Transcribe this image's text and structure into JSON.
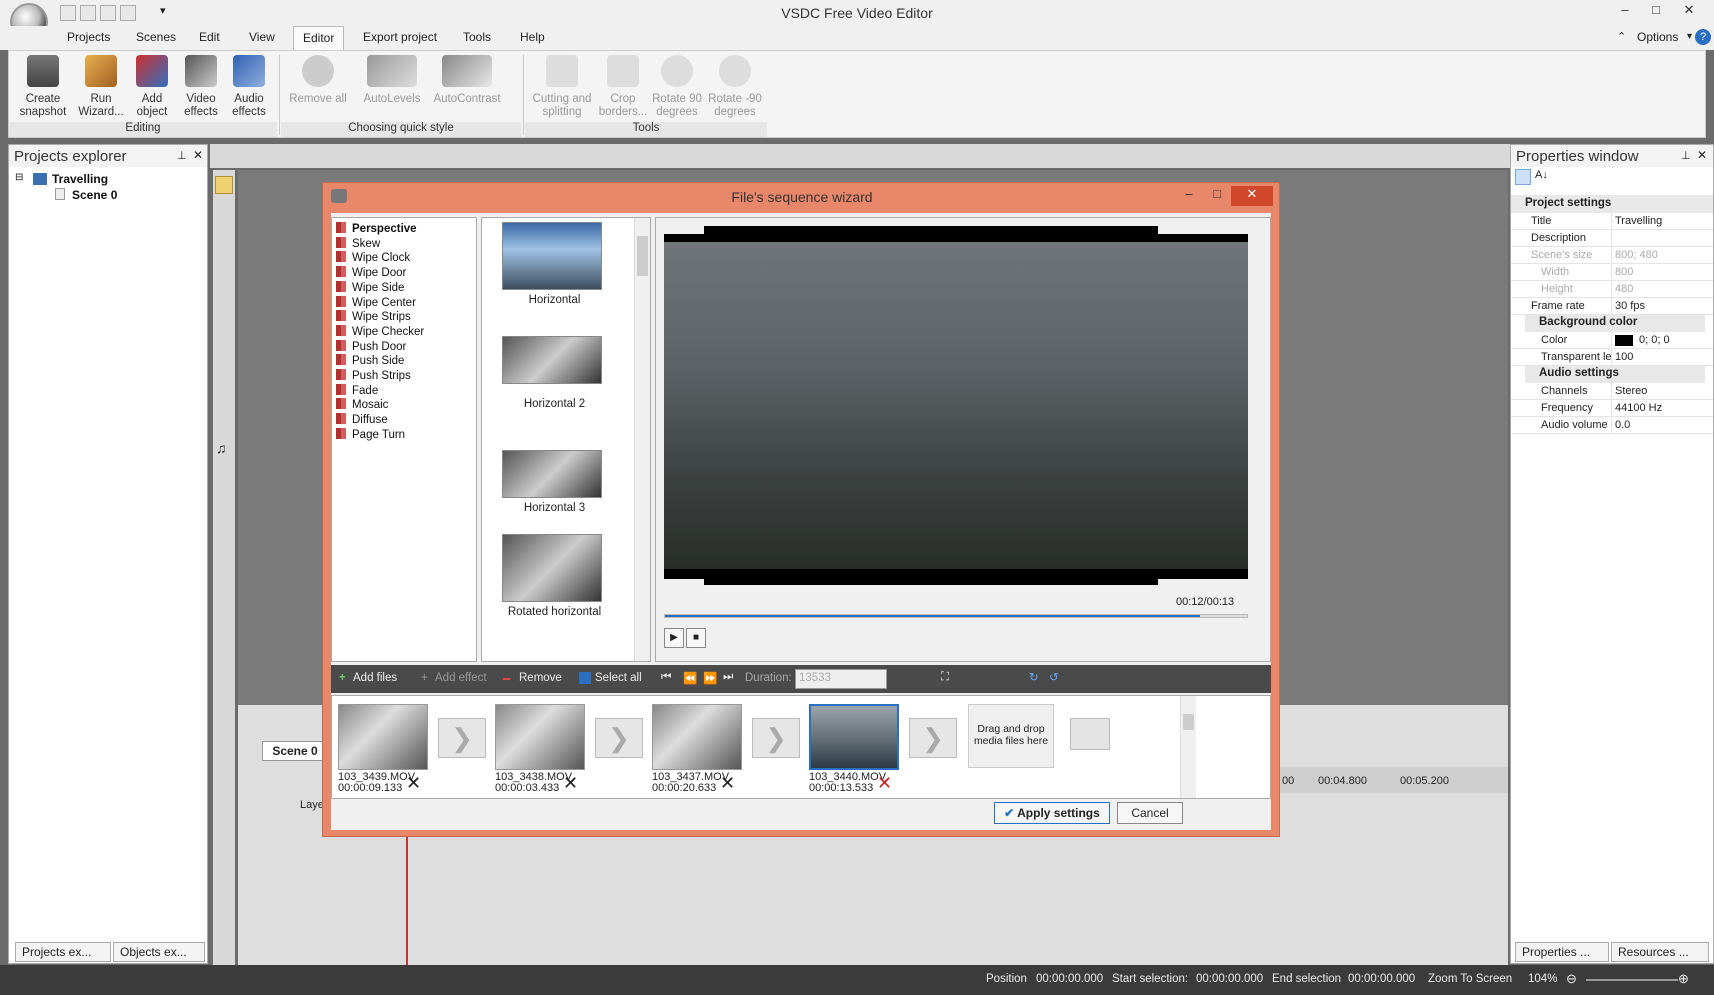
{
  "app": {
    "title": "VSDC Free Video Editor"
  },
  "menu": {
    "items": [
      "Projects",
      "Scenes",
      "Edit",
      "View",
      "Editor",
      "Export project",
      "Tools",
      "Help"
    ],
    "active": "Editor",
    "options": "Options"
  },
  "ribbon": {
    "editing": {
      "label": "Editing",
      "buttons": [
        {
          "l1": "Create",
          "l2": "snapshot"
        },
        {
          "l1": "Run",
          "l2": "Wizard..."
        },
        {
          "l1": "Add",
          "l2": "object"
        },
        {
          "l1": "Video",
          "l2": "effects"
        },
        {
          "l1": "Audio",
          "l2": "effects"
        }
      ]
    },
    "quick_style": {
      "label": "Choosing quick style",
      "buttons": [
        "Remove all",
        "AutoLevels",
        "AutoContrast"
      ]
    },
    "tools": {
      "label": "Tools",
      "buttons": [
        {
          "l1": "Cutting and",
          "l2": "splitting"
        },
        {
          "l1": "Crop",
          "l2": "borders..."
        },
        {
          "l1": "Rotate 90",
          "l2": "degrees"
        },
        {
          "l1": "Rotate -90",
          "l2": "degrees"
        }
      ]
    }
  },
  "projects_explorer": {
    "title": "Projects explorer",
    "project": "Travelling",
    "scene": "Scene 0",
    "tabs": [
      "Projects ex...",
      "Objects ex..."
    ]
  },
  "properties": {
    "title": "Properties window",
    "sections": {
      "project": "Project settings",
      "background": "Background color",
      "audio": "Audio settings"
    },
    "rows": [
      {
        "k": "Title",
        "v": "Travelling"
      },
      {
        "k": "Description",
        "v": ""
      },
      {
        "k": "Scene's size",
        "v": "800; 480"
      },
      {
        "k": "Width",
        "v": "800"
      },
      {
        "k": "Height",
        "v": "480"
      },
      {
        "k": "Frame rate",
        "v": "30 fps"
      },
      {
        "k": "Color",
        "v": "0; 0; 0"
      },
      {
        "k": "Transparent le",
        "v": "100"
      },
      {
        "k": "Channels",
        "v": "Stereo"
      },
      {
        "k": "Frequency",
        "v": "44100 Hz"
      },
      {
        "k": "Audio volume",
        "v": "0.0"
      }
    ],
    "tabs": [
      "Properties ...",
      "Resources ..."
    ]
  },
  "timeline": {
    "scene_tab": "Scene 0",
    "layer_label": "Laye",
    "ticks": [
      "00",
      "00:04.800",
      "00:05.200"
    ]
  },
  "status": {
    "position_label": "Position",
    "position": "00:00:00.000",
    "start_label": "Start selection:",
    "start": "00:00:00.000",
    "end_label": "End selection",
    "end": "00:00:00.000",
    "zoom_label": "Zoom To Screen",
    "zoom": "104%"
  },
  "dialog": {
    "title": "File's sequence wizard",
    "transitions": [
      "Perspective",
      "Skew",
      "Wipe Clock",
      "Wipe Door",
      "Wipe Side",
      "Wipe Center",
      "Wipe Strips",
      "Wipe Checker",
      "Push Door",
      "Push Side",
      "Push Strips",
      "Fade",
      "Mosaic",
      "Diffuse",
      "Page Turn"
    ],
    "selected_transition": "Perspective",
    "thumbnails": [
      "Horizontal",
      "Horizontal 2",
      "Horizontal 3",
      "Rotated horizontal"
    ],
    "time": "00:12/00:13",
    "progress": 0.92,
    "toolbar": {
      "add_files": "Add files",
      "add_effect": "Add effect",
      "remove": "Remove",
      "select_all": "Select all",
      "duration_label": "Duration:",
      "duration_value": "13533"
    },
    "clips": [
      {
        "name": "103_3439.MOV",
        "dur": "00:00:09.133"
      },
      {
        "name": "103_3438.MOV",
        "dur": "00:00:03.433"
      },
      {
        "name": "103_3437.MOV",
        "dur": "00:00:20.633"
      },
      {
        "name": "103_3440.MOV",
        "dur": "00:00:13.533"
      }
    ],
    "drop_hint": "Drag and drop media files here",
    "apply": "Apply settings",
    "cancel": "Cancel"
  },
  "colors": {
    "dialog_frame": "#e9876a",
    "accent_blue": "#2a6fc2",
    "remove_red": "#d02020"
  }
}
